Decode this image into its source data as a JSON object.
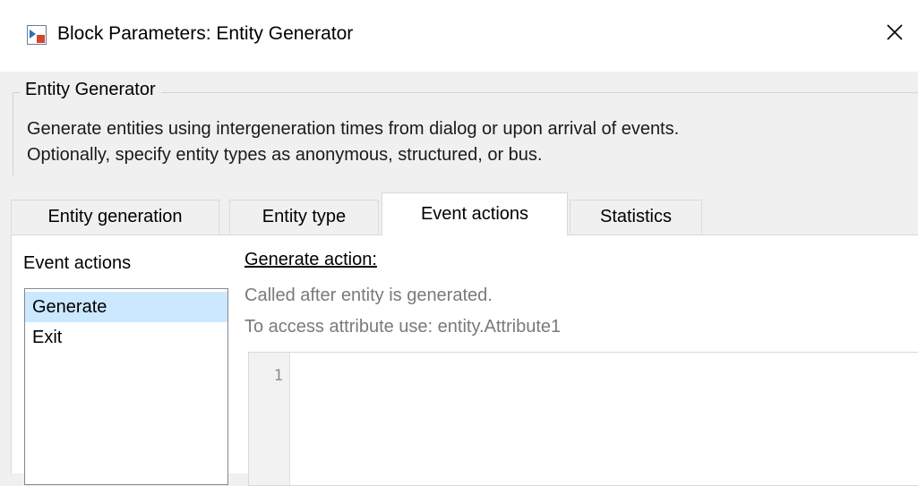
{
  "window": {
    "title": "Block Parameters: Entity Generator"
  },
  "block": {
    "name": "Entity Generator",
    "description_line1": "Generate entities using intergeneration times from dialog or upon arrival of events.",
    "description_line2": "Optionally, specify entity types as anonymous, structured, or bus."
  },
  "tabs": [
    {
      "label": "Entity generation"
    },
    {
      "label": "Entity type"
    },
    {
      "label": "Event actions"
    },
    {
      "label": "Statistics"
    }
  ],
  "event_actions": {
    "list_label": "Event actions",
    "items": [
      {
        "label": "Generate"
      },
      {
        "label": "Exit"
      }
    ],
    "selected": "Generate",
    "action_header": "Generate action:",
    "hint_line1": "Called after entity is generated.",
    "hint_line2": "To access attribute use: entity.Attribute1",
    "editor": {
      "line_numbers": [
        "1"
      ],
      "code": ""
    }
  },
  "colors": {
    "selection": "#cce8ff",
    "tab_active_bg": "#ffffff",
    "dialog_bg": "#f0f0f0"
  }
}
